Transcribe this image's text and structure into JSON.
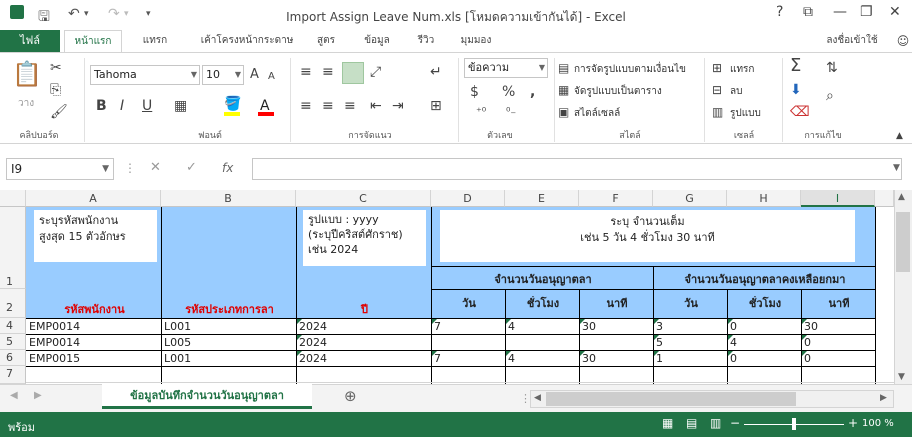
{
  "window": {
    "title": "Import Assign Leave Num.xls  [โหมดความเข้ากันได้] - Excel",
    "help": "?",
    "minimize": "—",
    "restore": "❐",
    "close": "✕"
  },
  "quick_access": {
    "save_icon": "save-icon",
    "undo_icon": "undo-icon",
    "redo_icon": "redo-icon"
  },
  "tabs": {
    "file": "ไฟล์",
    "items": [
      "หน้าแรก",
      "แทรก",
      "เค้าโครงหน้ากระดาษ",
      "สูตร",
      "ข้อมูล",
      "รีวิว",
      "มุมมอง"
    ],
    "active": "หน้าแรก",
    "signin": "ลงชื่อเข้าใช้"
  },
  "ribbon": {
    "clipboard": {
      "paste": "วาง",
      "label": "คลิปบอร์ด"
    },
    "font": {
      "name": "Tahoma",
      "size": "10",
      "grow": "A",
      "shrink": "A",
      "bold": "B",
      "italic": "I",
      "underline": "U",
      "label": "ฟอนต์"
    },
    "alignment": {
      "label": "การจัดแนว"
    },
    "number": {
      "format": "ข้อความ",
      "currency": "$",
      "percent": "%",
      "comma": ",",
      "label": "ตัวเลข"
    },
    "styles": {
      "conditional": "การจัดรูปแบบตามเงื่อนไข",
      "as_table": "จัดรูปแบบเป็นตาราง",
      "cell_styles": "สไตล์เซลล์",
      "label": "สไตล์"
    },
    "cells": {
      "insert": "แทรก",
      "delete": "ลบ",
      "format": "รูปแบบ",
      "label": "เซลล์"
    },
    "editing": {
      "sum": "Σ",
      "label": "การแก้ไข"
    }
  },
  "formula_bar": {
    "name_box": "I9",
    "cancel": "✕",
    "enter": "✓",
    "fx": "fx",
    "content": ""
  },
  "columns": [
    "A",
    "B",
    "C",
    "D",
    "E",
    "F",
    "G",
    "H",
    "I"
  ],
  "selected_column": "I",
  "rows": [
    "1",
    "2",
    "4",
    "5",
    "6",
    "7"
  ],
  "header_block": {
    "note_a": "ระบุรหัสพนักงาน\nสูงสุด 15 ตัวอักษร",
    "note_c": "รูปแบบ : yyyy\n(ระบุปีคริสต์ศักราช)\nเช่น 2024",
    "note_dh": "ระบุ จำนวนเต็ม\nเช่น 5 วัน 4 ชั่วโมง 30 นาที",
    "col_a": "รหัสพนักงาน",
    "col_b": "รหัสประเภทการลา",
    "col_c": "ปี",
    "group_def": "จำนวนวันอนุญาตลา",
    "group_rem": "จำนวนวันอนุญาตลาคงเหลือยกมา",
    "sub": [
      "วัน",
      "ชั่วโมง",
      "นาที",
      "วัน",
      "ชั่วโมง",
      "นาที"
    ]
  },
  "data_rows": [
    {
      "row": "4",
      "a": "EMP0014",
      "b": "L001",
      "c": "2024",
      "d": "7",
      "e": "4",
      "f": "30",
      "g": "3",
      "h": "0",
      "i": "30"
    },
    {
      "row": "5",
      "a": "EMP0014",
      "b": "L005",
      "c": "2024",
      "d": "",
      "e": "",
      "f": "",
      "g": "5",
      "h": "4",
      "i": "0"
    },
    {
      "row": "6",
      "a": "EMP0015",
      "b": "L001",
      "c": "2024",
      "d": "7",
      "e": "4",
      "f": "30",
      "g": "1",
      "h": "0",
      "i": "0"
    }
  ],
  "sheet_tabs": {
    "active": "ข้อมูลบันทึกจำนวนวันอนุญาตลา",
    "add": "⊕"
  },
  "status": {
    "ready": "พร้อม",
    "zoom": "100 %"
  },
  "colors": {
    "accent": "#217346",
    "header_fill": "#99ccff",
    "header_red": "#e00000"
  }
}
